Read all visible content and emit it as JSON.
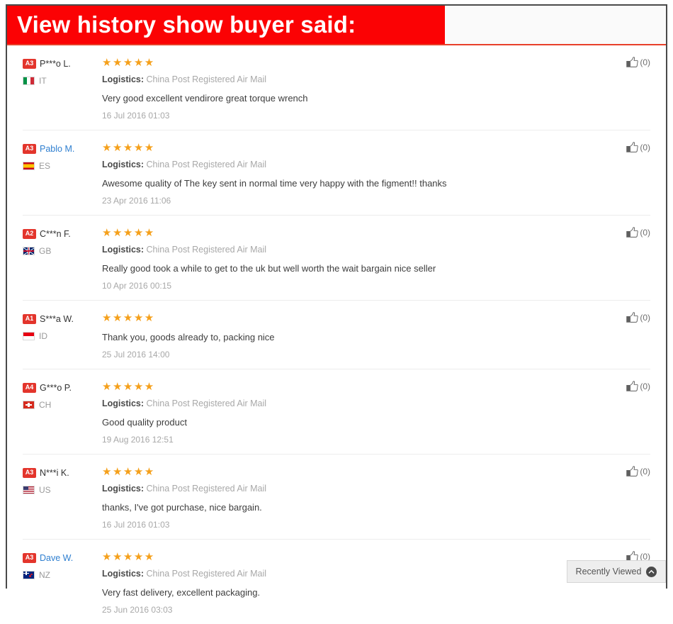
{
  "header": {
    "title": "View history show buyer said:"
  },
  "icons": {
    "thumbs_up": "thumbs-up-icon",
    "chevron_up": "chevron-up-icon"
  },
  "colors": {
    "banner_red": "#fb0204",
    "badge_red": "#e3352c",
    "star_orange": "#f5a01b",
    "link_blue": "#2f7fd0",
    "muted_gray": "#a8a8a8"
  },
  "labels": {
    "logistics_label": "Logistics:",
    "stars_full": "★★★★★"
  },
  "recently_viewed": {
    "label": "Recently Viewed"
  },
  "reviews": [
    {
      "rank": "A3",
      "name": "P***o L.",
      "name_is_link": false,
      "country_code": "IT",
      "flag": "flag-it",
      "stars": "★★★★★",
      "rating": 5,
      "logistics_label": "Logistics:",
      "logistics_value": "China Post Registered Air Mail",
      "comment": "Very good excellent vendirore great torque wrench",
      "date": "16 Jul 2016 01:03",
      "helpful_count": "(0)"
    },
    {
      "rank": "A3",
      "name": "Pablo M.",
      "name_is_link": true,
      "country_code": "ES",
      "flag": "flag-es",
      "stars": "★★★★★",
      "rating": 5,
      "logistics_label": "Logistics:",
      "logistics_value": "China Post Registered Air Mail",
      "comment": "Awesome quality of The key sent in normal time very happy with the figment!! thanks",
      "date": "23 Apr 2016 11:06",
      "helpful_count": "(0)"
    },
    {
      "rank": "A2",
      "name": "C***n F.",
      "name_is_link": false,
      "country_code": "GB",
      "flag": "flag-gb",
      "stars": "★★★★★",
      "rating": 5,
      "logistics_label": "Logistics:",
      "logistics_value": "China Post Registered Air Mail",
      "comment": "Really good took a while to get to the uk but well worth the wait bargain nice seller",
      "date": "10 Apr 2016 00:15",
      "helpful_count": "(0)"
    },
    {
      "rank": "A1",
      "name": "S***a W.",
      "name_is_link": false,
      "country_code": "ID",
      "flag": "flag-id",
      "stars": "★★★★★",
      "rating": 5,
      "logistics_label": "",
      "logistics_value": "",
      "comment": "Thank you, goods already to, packing nice",
      "date": "25 Jul 2016 14:00",
      "helpful_count": "(0)"
    },
    {
      "rank": "A4",
      "name": "G***o P.",
      "name_is_link": false,
      "country_code": "CH",
      "flag": "flag-ch",
      "stars": "★★★★★",
      "rating": 5,
      "logistics_label": "Logistics:",
      "logistics_value": "China Post Registered Air Mail",
      "comment": "Good quality product",
      "date": "19 Aug 2016 12:51",
      "helpful_count": "(0)"
    },
    {
      "rank": "A3",
      "name": "N***i K.",
      "name_is_link": false,
      "country_code": "US",
      "flag": "flag-us",
      "stars": "★★★★★",
      "rating": 5,
      "logistics_label": "Logistics:",
      "logistics_value": "China Post Registered Air Mail",
      "comment": "thanks, I've got purchase, nice bargain.",
      "date": "16 Jul 2016 01:03",
      "helpful_count": "(0)"
    },
    {
      "rank": "A3",
      "name": "Dave W.",
      "name_is_link": true,
      "country_code": "NZ",
      "flag": "flag-nz",
      "stars": "★★★★★",
      "rating": 5,
      "logistics_label": "Logistics:",
      "logistics_value": "China Post Registered Air Mail",
      "comment": "Very fast delivery, excellent packaging.",
      "date": "25 Jun 2016 03:03",
      "helpful_count": "(0)"
    }
  ]
}
